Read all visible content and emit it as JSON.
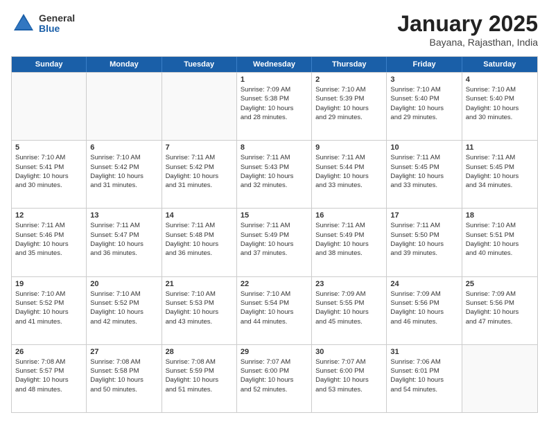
{
  "logo": {
    "general": "General",
    "blue": "Blue"
  },
  "header": {
    "month": "January 2025",
    "location": "Bayana, Rajasthan, India"
  },
  "days": [
    "Sunday",
    "Monday",
    "Tuesday",
    "Wednesday",
    "Thursday",
    "Friday",
    "Saturday"
  ],
  "rows": [
    [
      {
        "day": "",
        "lines": []
      },
      {
        "day": "",
        "lines": []
      },
      {
        "day": "",
        "lines": []
      },
      {
        "day": "1",
        "lines": [
          "Sunrise: 7:09 AM",
          "Sunset: 5:38 PM",
          "Daylight: 10 hours",
          "and 28 minutes."
        ]
      },
      {
        "day": "2",
        "lines": [
          "Sunrise: 7:10 AM",
          "Sunset: 5:39 PM",
          "Daylight: 10 hours",
          "and 29 minutes."
        ]
      },
      {
        "day": "3",
        "lines": [
          "Sunrise: 7:10 AM",
          "Sunset: 5:40 PM",
          "Daylight: 10 hours",
          "and 29 minutes."
        ]
      },
      {
        "day": "4",
        "lines": [
          "Sunrise: 7:10 AM",
          "Sunset: 5:40 PM",
          "Daylight: 10 hours",
          "and 30 minutes."
        ]
      }
    ],
    [
      {
        "day": "5",
        "lines": [
          "Sunrise: 7:10 AM",
          "Sunset: 5:41 PM",
          "Daylight: 10 hours",
          "and 30 minutes."
        ]
      },
      {
        "day": "6",
        "lines": [
          "Sunrise: 7:10 AM",
          "Sunset: 5:42 PM",
          "Daylight: 10 hours",
          "and 31 minutes."
        ]
      },
      {
        "day": "7",
        "lines": [
          "Sunrise: 7:11 AM",
          "Sunset: 5:42 PM",
          "Daylight: 10 hours",
          "and 31 minutes."
        ]
      },
      {
        "day": "8",
        "lines": [
          "Sunrise: 7:11 AM",
          "Sunset: 5:43 PM",
          "Daylight: 10 hours",
          "and 32 minutes."
        ]
      },
      {
        "day": "9",
        "lines": [
          "Sunrise: 7:11 AM",
          "Sunset: 5:44 PM",
          "Daylight: 10 hours",
          "and 33 minutes."
        ]
      },
      {
        "day": "10",
        "lines": [
          "Sunrise: 7:11 AM",
          "Sunset: 5:45 PM",
          "Daylight: 10 hours",
          "and 33 minutes."
        ]
      },
      {
        "day": "11",
        "lines": [
          "Sunrise: 7:11 AM",
          "Sunset: 5:45 PM",
          "Daylight: 10 hours",
          "and 34 minutes."
        ]
      }
    ],
    [
      {
        "day": "12",
        "lines": [
          "Sunrise: 7:11 AM",
          "Sunset: 5:46 PM",
          "Daylight: 10 hours",
          "and 35 minutes."
        ]
      },
      {
        "day": "13",
        "lines": [
          "Sunrise: 7:11 AM",
          "Sunset: 5:47 PM",
          "Daylight: 10 hours",
          "and 36 minutes."
        ]
      },
      {
        "day": "14",
        "lines": [
          "Sunrise: 7:11 AM",
          "Sunset: 5:48 PM",
          "Daylight: 10 hours",
          "and 36 minutes."
        ]
      },
      {
        "day": "15",
        "lines": [
          "Sunrise: 7:11 AM",
          "Sunset: 5:49 PM",
          "Daylight: 10 hours",
          "and 37 minutes."
        ]
      },
      {
        "day": "16",
        "lines": [
          "Sunrise: 7:11 AM",
          "Sunset: 5:49 PM",
          "Daylight: 10 hours",
          "and 38 minutes."
        ]
      },
      {
        "day": "17",
        "lines": [
          "Sunrise: 7:11 AM",
          "Sunset: 5:50 PM",
          "Daylight: 10 hours",
          "and 39 minutes."
        ]
      },
      {
        "day": "18",
        "lines": [
          "Sunrise: 7:10 AM",
          "Sunset: 5:51 PM",
          "Daylight: 10 hours",
          "and 40 minutes."
        ]
      }
    ],
    [
      {
        "day": "19",
        "lines": [
          "Sunrise: 7:10 AM",
          "Sunset: 5:52 PM",
          "Daylight: 10 hours",
          "and 41 minutes."
        ]
      },
      {
        "day": "20",
        "lines": [
          "Sunrise: 7:10 AM",
          "Sunset: 5:52 PM",
          "Daylight: 10 hours",
          "and 42 minutes."
        ]
      },
      {
        "day": "21",
        "lines": [
          "Sunrise: 7:10 AM",
          "Sunset: 5:53 PM",
          "Daylight: 10 hours",
          "and 43 minutes."
        ]
      },
      {
        "day": "22",
        "lines": [
          "Sunrise: 7:10 AM",
          "Sunset: 5:54 PM",
          "Daylight: 10 hours",
          "and 44 minutes."
        ]
      },
      {
        "day": "23",
        "lines": [
          "Sunrise: 7:09 AM",
          "Sunset: 5:55 PM",
          "Daylight: 10 hours",
          "and 45 minutes."
        ]
      },
      {
        "day": "24",
        "lines": [
          "Sunrise: 7:09 AM",
          "Sunset: 5:56 PM",
          "Daylight: 10 hours",
          "and 46 minutes."
        ]
      },
      {
        "day": "25",
        "lines": [
          "Sunrise: 7:09 AM",
          "Sunset: 5:56 PM",
          "Daylight: 10 hours",
          "and 47 minutes."
        ]
      }
    ],
    [
      {
        "day": "26",
        "lines": [
          "Sunrise: 7:08 AM",
          "Sunset: 5:57 PM",
          "Daylight: 10 hours",
          "and 48 minutes."
        ]
      },
      {
        "day": "27",
        "lines": [
          "Sunrise: 7:08 AM",
          "Sunset: 5:58 PM",
          "Daylight: 10 hours",
          "and 50 minutes."
        ]
      },
      {
        "day": "28",
        "lines": [
          "Sunrise: 7:08 AM",
          "Sunset: 5:59 PM",
          "Daylight: 10 hours",
          "and 51 minutes."
        ]
      },
      {
        "day": "29",
        "lines": [
          "Sunrise: 7:07 AM",
          "Sunset: 6:00 PM",
          "Daylight: 10 hours",
          "and 52 minutes."
        ]
      },
      {
        "day": "30",
        "lines": [
          "Sunrise: 7:07 AM",
          "Sunset: 6:00 PM",
          "Daylight: 10 hours",
          "and 53 minutes."
        ]
      },
      {
        "day": "31",
        "lines": [
          "Sunrise: 7:06 AM",
          "Sunset: 6:01 PM",
          "Daylight: 10 hours",
          "and 54 minutes."
        ]
      },
      {
        "day": "",
        "lines": []
      }
    ]
  ]
}
